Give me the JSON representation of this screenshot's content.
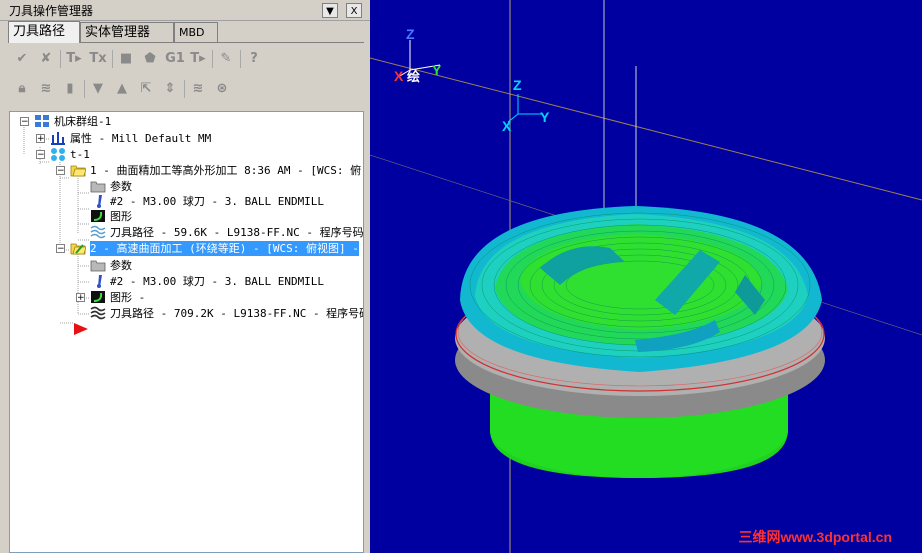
{
  "panel": {
    "title": "刀具操作管理器",
    "pin_glyph": "▼",
    "close_glyph": "X",
    "tabs": [
      "刀具路径",
      "实体管理器",
      "MBD"
    ]
  },
  "toolbar": {
    "g1_label": "G1"
  },
  "tree": {
    "root": "机床群组-1",
    "properties": "属性 - Mill Default MM",
    "toolgroup": "t-1",
    "op1": {
      "label": "1 - 曲面精加工等高外形加工 8:36 AM - [WCS: 俯",
      "params": "参数",
      "tool": "#2 - M3.00 球刀 - 3. BALL ENDMILL",
      "geometry": "图形",
      "path": "刀具路径 - 59.6K - L9138-FF.NC - 程序号码"
    },
    "op2": {
      "label": "2 - 高速曲面加工 (环绕等距) - [WCS: 俯视图] -",
      "params": "参数",
      "tool": "#2 - M3.00 球刀 -  3. BALL ENDMILL",
      "geometry": "图形 -",
      "path": "刀具路径 - 709.2K - L9138-FF.NC - 程序号码"
    }
  },
  "viewport": {
    "bg": "#0000a0",
    "gview": {
      "x": "X",
      "y": "Y",
      "z": "Z",
      "tag": "绘"
    },
    "wcs": {
      "x": "X",
      "y": "Y",
      "z": "Z"
    },
    "watermark": "三维网www.3dportal.cn"
  }
}
